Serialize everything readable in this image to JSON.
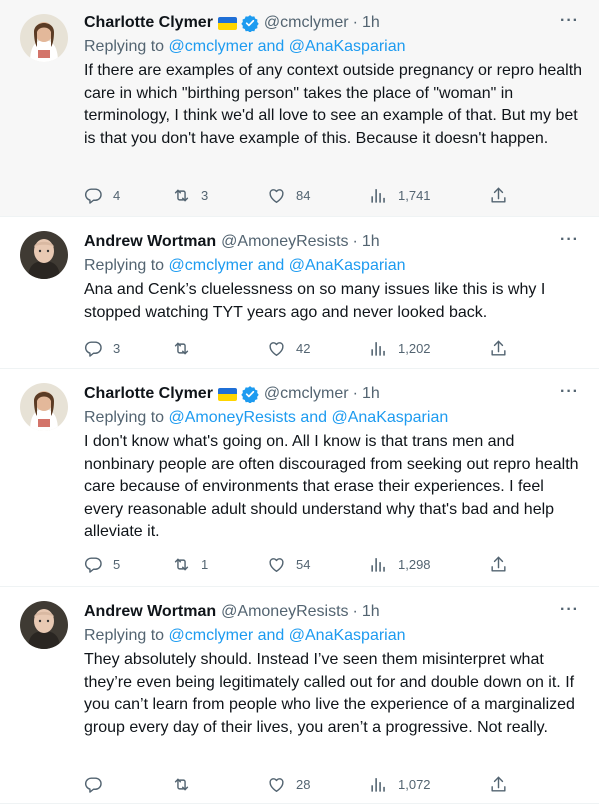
{
  "tweets": [
    {
      "name": "Charlotte Clymer",
      "handle": "@cmclymer",
      "time": "1h",
      "reply_prefix": "Replying to",
      "reply_to": "@cmclymer and @AnaKasparian",
      "text": "If there are examples of any context outside pregnancy or repro health care in which \"birthing person\" takes the place of \"woman\" in terminology, I think we'd all love to see an example of that. But my bet is that you don't have example of this. Because it doesn't happen.",
      "replies": "4",
      "retweets": "3",
      "likes": "84",
      "views": "1,741"
    },
    {
      "name": "Andrew Wortman",
      "handle": "@AmoneyResists",
      "time": "1h",
      "reply_prefix": "Replying to",
      "reply_to": "@cmclymer and @AnaKasparian",
      "text": "Ana and Cenk’s cluelessness on so many issues like this is why I stopped watching TYT years ago and never looked back.",
      "replies": "3",
      "retweets": "",
      "likes": "42",
      "views": "1,202"
    },
    {
      "name": "Charlotte Clymer",
      "handle": "@cmclymer",
      "time": "1h",
      "reply_prefix": "Replying to",
      "reply_to": "@AmoneyResists and @AnaKasparian",
      "text": "I don't know what's going on. All I know is that trans men and nonbinary people are often discouraged from seeking out repro health care because of environments that erase their experiences. I feel every reasonable adult should understand why that's bad and help alleviate it.",
      "replies": "5",
      "retweets": "1",
      "likes": "54",
      "views": "1,298"
    },
    {
      "name": "Andrew Wortman",
      "handle": "@AmoneyResists",
      "time": "1h",
      "reply_prefix": "Replying to",
      "reply_to": "@cmclymer and @AnaKasparian",
      "text": "They absolutely should. Instead I’ve seen them misinterpret what they’re even being legitimately called out for and double down on it. If you can’t learn from people who live the experience of a marginalized group every day of their lives, you aren’t a progressive. Not really.",
      "replies": "",
      "retweets": "",
      "likes": "28",
      "views": "1,072"
    }
  ],
  "icons": {
    "more": "more-icon",
    "reply": "reply-icon",
    "retweet": "retweet-icon",
    "like": "heart-icon",
    "views": "analytics-icon",
    "share": "share-icon",
    "verified": "verified-badge-icon",
    "flag": "ukraine-flag-icon"
  },
  "colors": {
    "link": "#1d9bf0",
    "secondary_text": "#536471",
    "highlight_bg": "#f7f7f7",
    "flag_blue": "#1f6fd6",
    "flag_yellow": "#ffd500"
  }
}
